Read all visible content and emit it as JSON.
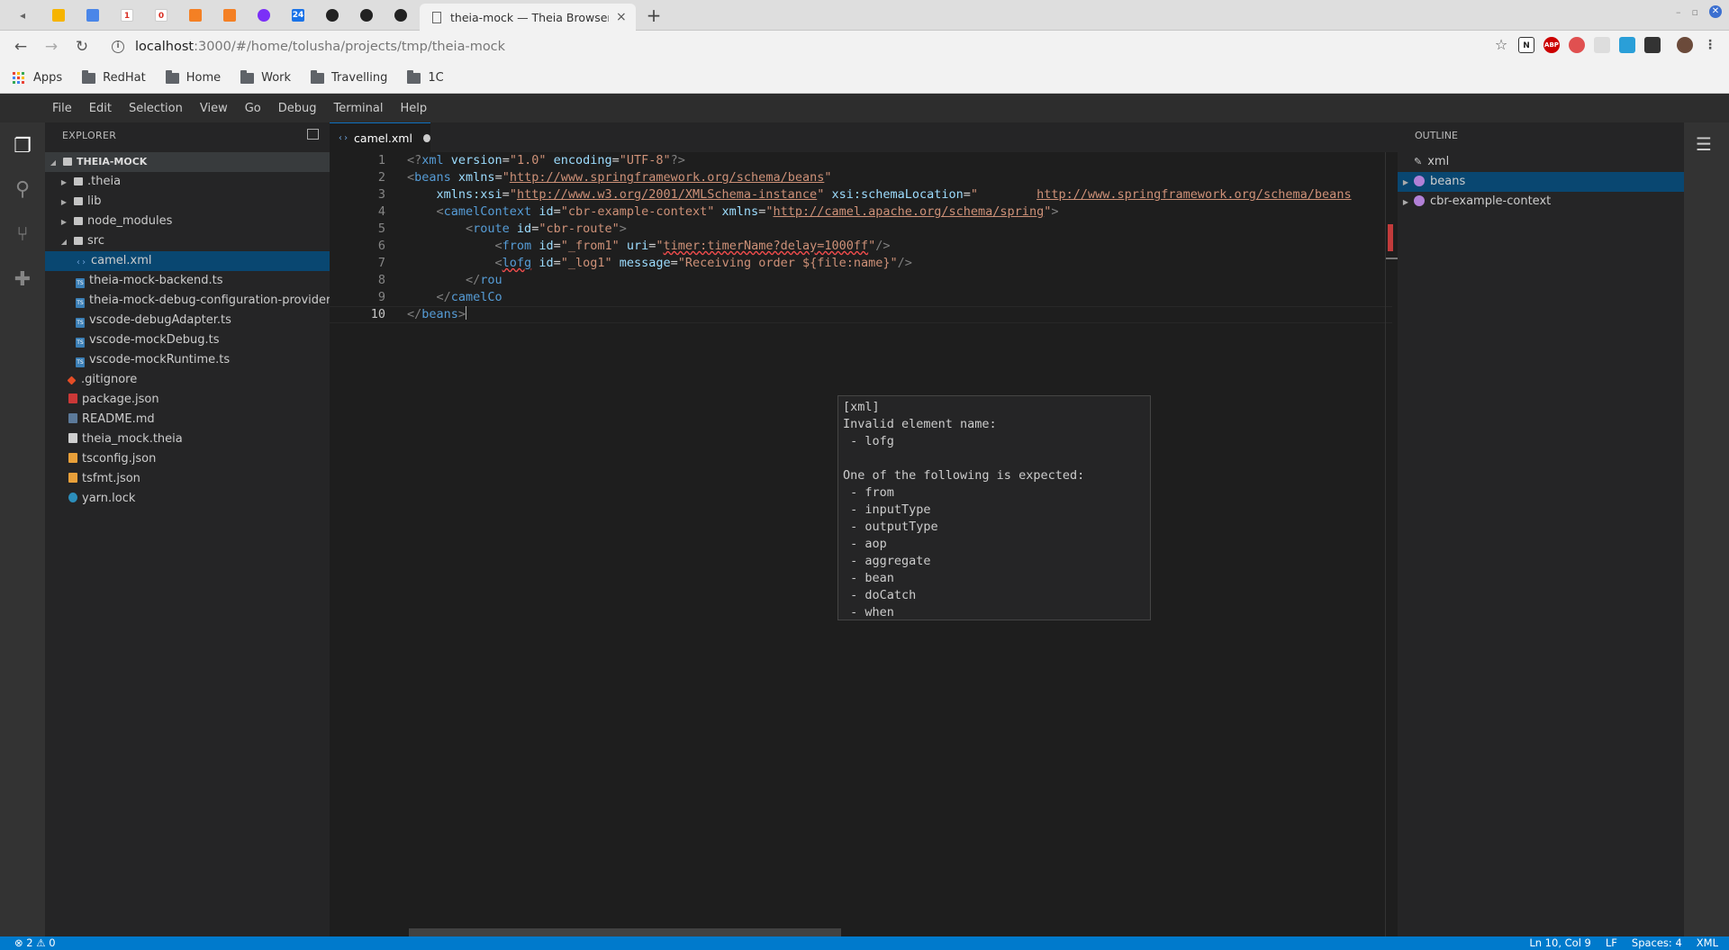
{
  "browser": {
    "active_tab_title": "theia-mock — Theia Browser Ex",
    "url_host": "localhost",
    "url_path": ":3000/#/home/tolusha/projects/tmp/theia-mock",
    "pinned_tab_badges": {
      "gmail1": "1",
      "gmail2": "0",
      "calendar": "24"
    },
    "extension_labels": {
      "n": "N",
      "abp": "ABP"
    },
    "bookmarks": [
      "RedHat",
      "Home",
      "Work",
      "Travelling",
      "1C"
    ],
    "apps_label": "Apps",
    "new_tab_label": "+",
    "close_label": "×"
  },
  "menu": [
    "File",
    "Edit",
    "Selection",
    "View",
    "Go",
    "Debug",
    "Terminal",
    "Help"
  ],
  "explorer": {
    "header": "EXPLORER",
    "root": "THEIA-MOCK",
    "items": [
      {
        "label": ".theia"
      },
      {
        "label": "lib"
      },
      {
        "label": "node_modules"
      },
      {
        "label": "src"
      },
      {
        "label": "camel.xml"
      },
      {
        "label": "theia-mock-backend.ts"
      },
      {
        "label": "theia-mock-debug-configuration-provider.ts"
      },
      {
        "label": "vscode-debugAdapter.ts"
      },
      {
        "label": "vscode-mockDebug.ts"
      },
      {
        "label": "vscode-mockRuntime.ts"
      },
      {
        "label": ".gitignore"
      },
      {
        "label": "package.json"
      },
      {
        "label": "README.md"
      },
      {
        "label": "theia_mock.theia"
      },
      {
        "label": "tsconfig.json"
      },
      {
        "label": "tsfmt.json"
      },
      {
        "label": "yarn.lock"
      }
    ]
  },
  "editor": {
    "tab_label": "camel.xml",
    "line_numbers": [
      "1",
      "2",
      "3",
      "4",
      "5",
      "6",
      "7",
      "8",
      "9",
      "10"
    ],
    "tokens": {
      "l1a": "<?",
      "l1b": "xml",
      "l1c": " version",
      "l1d": "=",
      "l1e": "\"1.0\"",
      "l1f": " encoding",
      "l1g": "=",
      "l1h": "\"UTF-8\"",
      "l1i": "?>",
      "l2a": "<",
      "l2b": "beans",
      "l2c": " xmlns",
      "l2d": "=",
      "l2e": "\"",
      "l2f": "http://www.springframework.org/schema/beans",
      "l2g": "\"",
      "l3a": "    xmlns:xsi",
      "l3b": "=",
      "l3c": "\"",
      "l3d": "http://www.w3.org/2001/XMLSchema-instance",
      "l3e": "\"",
      "l3f": " xsi:schemaLocation",
      "l3g": "=",
      "l3h": "\"        ",
      "l3i": "http://www.springframework.org/schema/beans",
      "l4a": "    <",
      "l4b": "camelContext",
      "l4c": " id",
      "l4d": "=",
      "l4e": "\"cbr-example-context\"",
      "l4f": " xmlns",
      "l4g": "=",
      "l4h": "\"",
      "l4i": "http://camel.apache.org/schema/spring",
      "l4j": "\"",
      "l4k": ">",
      "l5a": "        <",
      "l5b": "route",
      "l5c": " id",
      "l5d": "=",
      "l5e": "\"cbr-route\"",
      "l5f": ">",
      "l6a": "            <",
      "l6b": "from",
      "l6c": " id",
      "l6d": "=",
      "l6e": "\"_from1\"",
      "l6f": " uri",
      "l6g": "=",
      "l6h": "\"",
      "l6i": "timer:timerName?delay=1000ff",
      "l6j": "\"",
      "l6k": "/>",
      "l7a": "            <",
      "l7b": "lofg",
      "l7c": " id",
      "l7d": "=",
      "l7e": "\"_log1\"",
      "l7f": " message",
      "l7g": "=",
      "l7h": "\"Receiving order ${file:name}\"",
      "l7i": "/>",
      "l8a": "        </",
      "l8b": "rou",
      "l9a": "    </",
      "l9b": "camelCo",
      "l10a": "</",
      "l10b": "beans",
      "l10c": ">"
    },
    "hover": "[xml]\nInvalid element name:\n - lofg\n\nOne of the following is expected:\n - from\n - inputType\n - outputType\n - aop\n - aggregate\n - bean\n - doCatch\n - when"
  },
  "outline": {
    "header": "OUTLINE",
    "items": [
      "xml",
      "beans",
      "cbr-example-context"
    ]
  },
  "status": {
    "errors": "2",
    "warnings": "0",
    "position": "Ln 10, Col 9",
    "eol": "LF",
    "spaces": "Spaces: 4",
    "language": "XML"
  },
  "colors": {
    "accent": "#007acc",
    "selection": "#094771",
    "error": "#f14c4c"
  }
}
